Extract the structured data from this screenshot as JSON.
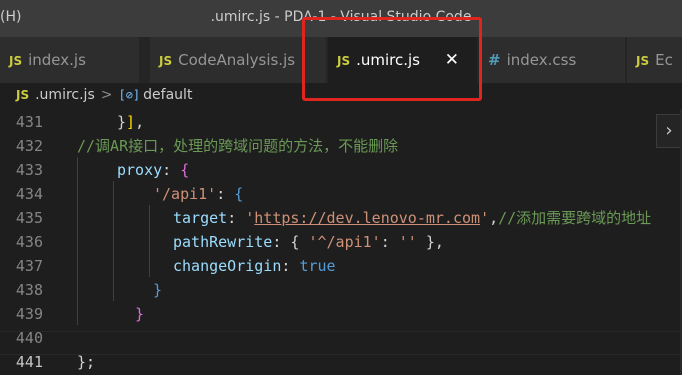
{
  "window": {
    "menu_fragment": "(H)",
    "title": ".umirc.js - PDA-1 - Visual Studio Code"
  },
  "tabs": [
    {
      "icon": "JS",
      "label": "index.js",
      "active": false
    },
    {
      "icon": "JS",
      "label": "CodeAnalysis.js",
      "active": false
    },
    {
      "icon": "JS",
      "label": ".umirc.js",
      "active": true,
      "close": "✕"
    },
    {
      "icon": "#",
      "label": "index.css",
      "active": false
    },
    {
      "icon": "JS",
      "label": "Ec",
      "active": false
    }
  ],
  "breadcrumb": {
    "file_icon": "JS",
    "file": ".umirc.js",
    "separator": ">",
    "symbol_icon": "[⊘]",
    "symbol": "default"
  },
  "editor": {
    "lines": [
      {
        "num": "431",
        "parts": [
          [
            "p",
            "}"
          ],
          [
            "y",
            "]"
          ],
          [
            "p",
            ","
          ]
        ]
      },
      {
        "num": "432",
        "parts": [
          [
            "c",
            "//调AR接口，处理的跨域问题的方法，不能删除"
          ]
        ]
      },
      {
        "num": "433",
        "parts": [
          [
            "k",
            "proxy"
          ],
          [
            "p",
            ": "
          ],
          [
            "pk",
            "{"
          ]
        ]
      },
      {
        "num": "434",
        "parts": [
          [
            "s",
            "'/api1'"
          ],
          [
            "p",
            ": "
          ],
          [
            "b",
            "{"
          ]
        ]
      },
      {
        "num": "435",
        "parts": [
          [
            "k",
            "target"
          ],
          [
            "p",
            ": "
          ],
          [
            "s",
            "'"
          ],
          [
            "su",
            "https://dev.lenovo-mr.com"
          ],
          [
            "s",
            "'"
          ],
          [
            "p",
            ","
          ],
          [
            "c",
            "//添加需要跨域的地址"
          ]
        ]
      },
      {
        "num": "436",
        "parts": [
          [
            "k",
            "pathRewrite"
          ],
          [
            "p",
            ": { "
          ],
          [
            "s",
            "'^/api1'"
          ],
          [
            "p",
            ": "
          ],
          [
            "s",
            "''"
          ],
          [
            "p",
            " },"
          ]
        ]
      },
      {
        "num": "437",
        "parts": [
          [
            "k",
            "changeOrigin"
          ],
          [
            "p",
            ": "
          ],
          [
            "b",
            "true"
          ]
        ]
      },
      {
        "num": "438",
        "parts": [
          [
            "b",
            "}"
          ]
        ]
      },
      {
        "num": "439",
        "parts": [
          [
            "pk",
            "}"
          ]
        ]
      },
      {
        "num": "440",
        "parts": []
      },
      {
        "num": "441",
        "parts": [
          [
            "p",
            "};"
          ]
        ]
      }
    ],
    "current_line": "441"
  },
  "icons": {
    "scroll_chevron": "›"
  },
  "colors": {
    "keyword": "#9cdcfe",
    "string": "#ce9178",
    "comment": "#6a9955",
    "boolean": "#569cd6",
    "annotation": "#e0241e"
  }
}
